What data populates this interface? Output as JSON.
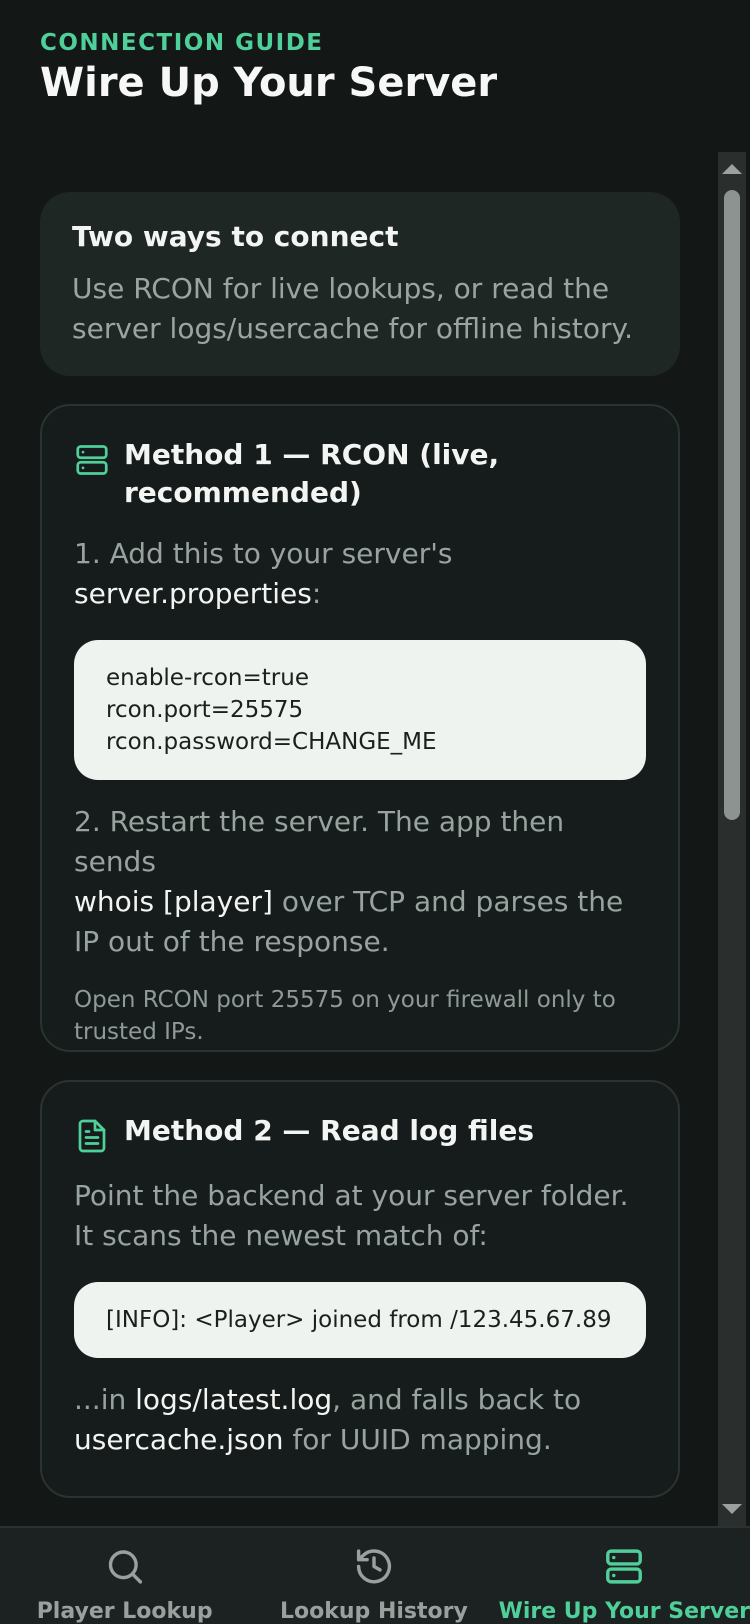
{
  "header": {
    "eyebrow": "CONNECTION GUIDE",
    "title": "Wire Up Your Server"
  },
  "intro": {
    "title": "Two ways to connect",
    "text": "Use RCON for live lookups, or read the server logs/usercache for offline history."
  },
  "method1": {
    "icon": "server-icon",
    "title": "Method 1 — RCON (live, recommended)",
    "step1_prefix": "1. Add this to your server's",
    "step1_file": "server.properties",
    "step1_suffix": ":",
    "code_lines": [
      "enable-rcon=true",
      "rcon.port=25575",
      "rcon.password=CHANGE_ME"
    ],
    "step2_prefix": "2. Restart the server. The app then sends",
    "step2_command": "whois [player]",
    "step2_suffix": " over TCP and parses the IP out of the response.",
    "note": "Open RCON port 25575 on your firewall only to trusted IPs."
  },
  "method2": {
    "icon": "file-text-icon",
    "title": "Method 2 — Read log files",
    "intro": "Point the backend at your server folder. It scans the newest match of:",
    "code_line": "[INFO]: <Player> joined from /123.45.67.89",
    "outro_prefix": "...in ",
    "outro_file": "logs/latest.log",
    "outro_middle": ", and falls back to",
    "outro_cache": "usercache.json",
    "outro_suffix": " for UUID mapping."
  },
  "tabs": [
    {
      "label": "Player Lookup",
      "icon": "search-icon",
      "active": false
    },
    {
      "label": "Lookup History",
      "icon": "history-icon",
      "active": false
    },
    {
      "label": "Wire Up Your Server",
      "icon": "server-icon",
      "active": true
    }
  ],
  "colors": {
    "background": "#131716",
    "accent": "#4fcf9a",
    "card": "#1f2725",
    "code_bg": "#eef3ef"
  }
}
